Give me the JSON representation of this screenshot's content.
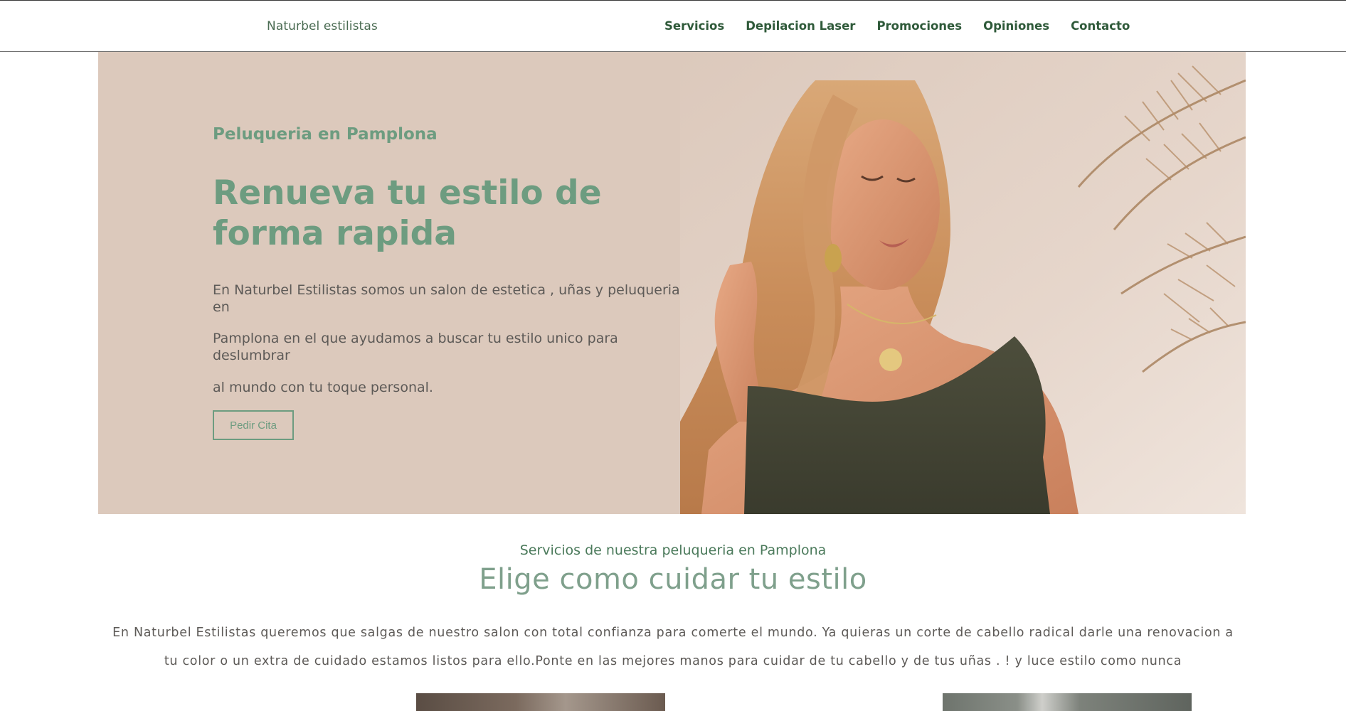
{
  "header": {
    "brand": "Naturbel estilistas",
    "nav": [
      {
        "label": "Servicios"
      },
      {
        "label": "Depilacion Laser"
      },
      {
        "label": "Promociones"
      },
      {
        "label": "Opiniones"
      },
      {
        "label": "Contacto"
      }
    ]
  },
  "hero": {
    "kicker": "Peluqueria en Pamplona",
    "title": "Renueva tu estilo de forma rapida",
    "paragraphs": [
      "En Naturbel Estilistas somos un salon de estetica , uñas y peluqueria en",
      "Pamplona en el que ayudamos a buscar tu estilo unico para deslumbrar",
      "al mundo con tu toque personal."
    ],
    "cta_label": "Pedir Cita"
  },
  "services": {
    "kicker": "Servicios de nuestra peluqueria en Pamplona",
    "title": "Elige como cuidar tu estilo",
    "description": "En Naturbel Estilistas queremos que salgas de nuestro salon con total confianza para comerte el mundo. Ya quieras un corte de cabello radical darle una renovacion a tu color o un extra de cuidado estamos listos para ello.Ponte en las mejores manos para cuidar de tu cabello y de tus uñas . ! y luce estilo como nunca"
  },
  "colors": {
    "accent_green": "#6d9c80",
    "nav_green": "#2f5a3a",
    "hero_bg": "#dcc9bc",
    "body_text": "#5d5a57"
  }
}
